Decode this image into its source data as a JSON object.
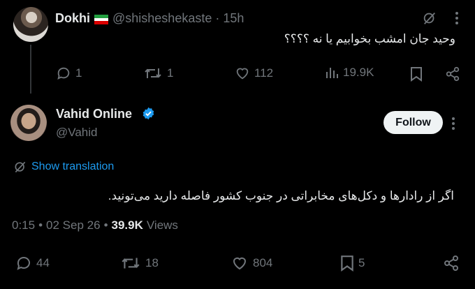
{
  "parent": {
    "name": "Dokhi",
    "flag_colors": [
      "#239f40",
      "#ffffff",
      "#da0000"
    ],
    "handle": "@shisheshekaste",
    "separator": "·",
    "time": "15h",
    "text": "وحید جان امشب بخوابیم یا نه ؟؟؟؟",
    "actions": {
      "reply_count": "1",
      "repost_count": "1",
      "like_count": "112",
      "view_count": "19.9K"
    }
  },
  "tweet": {
    "name": "Vahid Online",
    "handle": "@Vahid",
    "follow_label": "Follow",
    "show_translation": "Show translation",
    "text": "اگر از رادارها و دکل‌های مخابراتی در جنوب کشور فاصله دارید می‌تونید.",
    "time": "0:15",
    "dot": "•",
    "date": "02 Sep 26",
    "views_count": "39.9K",
    "views_label": "Views",
    "actions": {
      "reply_count": "44",
      "repost_count": "18",
      "like_count": "804",
      "bookmark_count": "5"
    }
  },
  "colors": {
    "background": "#000000",
    "text": "#e7e9ea",
    "muted": "#71767b",
    "accent": "#1d9bf0"
  },
  "icons": [
    "grok-icon",
    "more-icon",
    "reply-icon",
    "repost-icon",
    "like-icon",
    "views-icon",
    "bookmark-icon",
    "share-icon",
    "verified-icon",
    "translate-icon"
  ]
}
